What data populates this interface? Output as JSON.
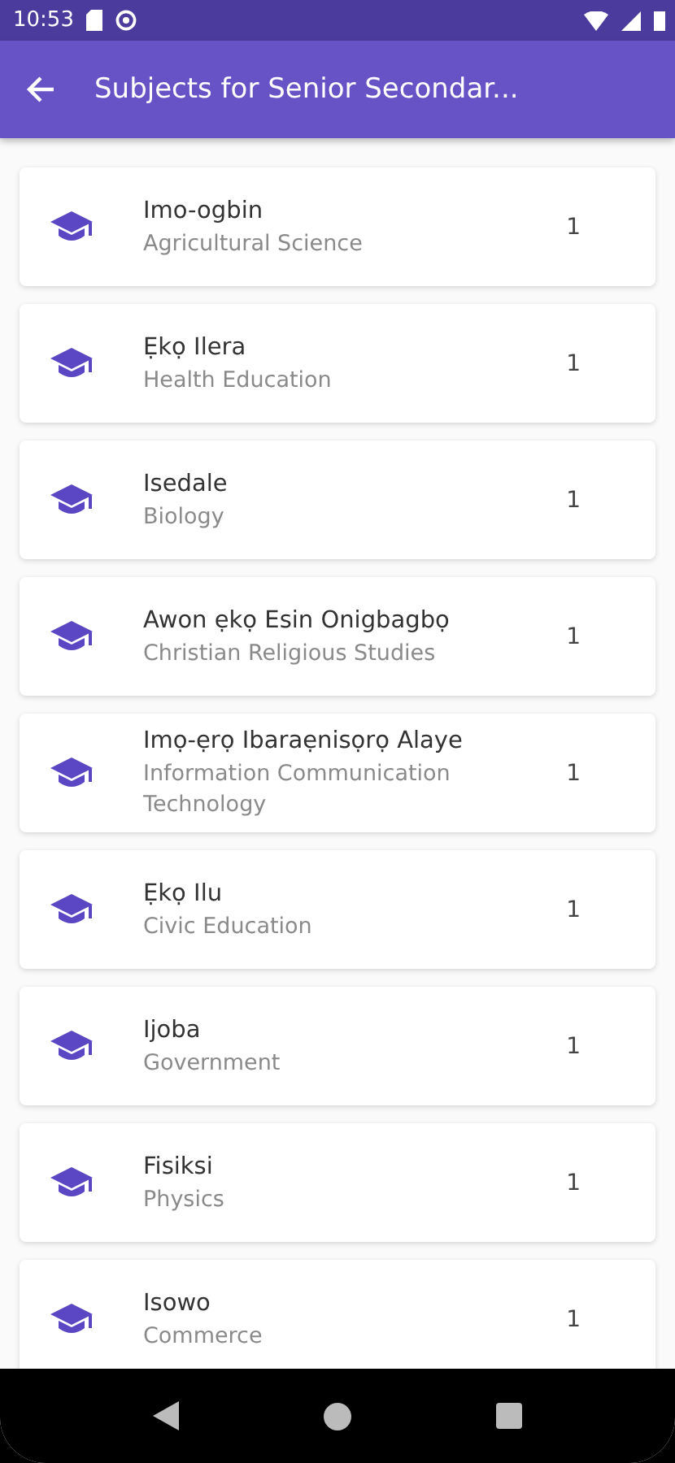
{
  "status_bar": {
    "time": "10:53"
  },
  "app_bar": {
    "title": "Subjects for Senior Secondar..."
  },
  "subjects": [
    {
      "name": "Imo-ogbin",
      "english": "Agricultural Science",
      "count": "1"
    },
    {
      "name": "Ẹkọ Ilera",
      "english": "Health Education",
      "count": "1"
    },
    {
      "name": "Isedale",
      "english": "Biology",
      "count": "1"
    },
    {
      "name": "Awon ẹkọ Esin Onigbagbọ",
      "english": "Christian Religious Studies",
      "count": "1"
    },
    {
      "name": "Imọ-ẹrọ Ibaraẹnisọrọ Alaye",
      "english": "Information Communication Technology",
      "count": "1"
    },
    {
      "name": "Ẹkọ Ilu",
      "english": "Civic Education",
      "count": "1"
    },
    {
      "name": "Ijoba",
      "english": "Government",
      "count": "1"
    },
    {
      "name": "Fisiksi",
      "english": "Physics",
      "count": "1"
    },
    {
      "name": "Isowo",
      "english": "Commerce",
      "count": "1"
    }
  ]
}
